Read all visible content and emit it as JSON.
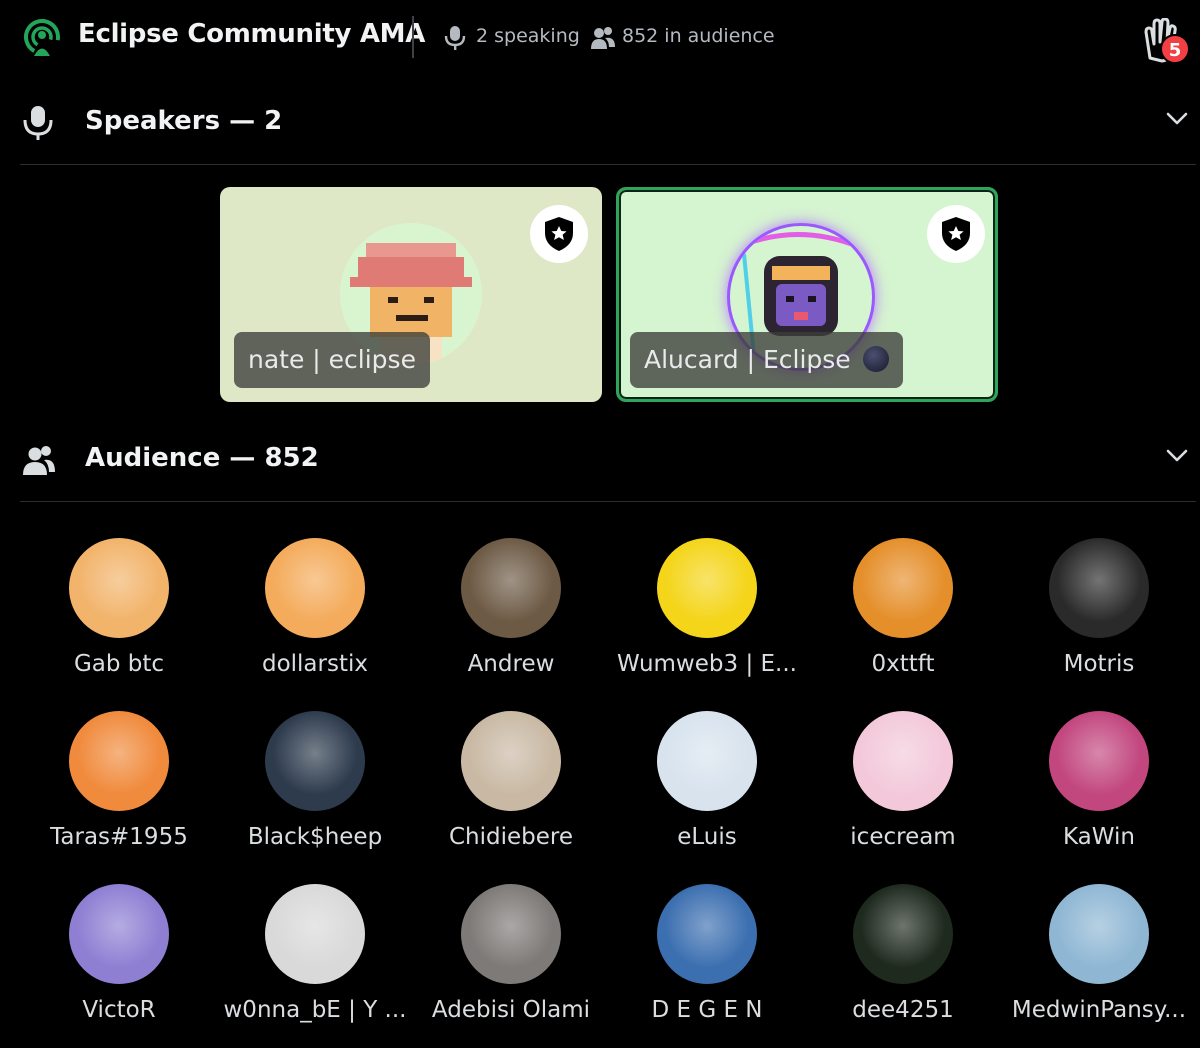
{
  "header": {
    "title": "Eclipse Community AMA",
    "speaking": "2 speaking",
    "audience": "852 in audience",
    "raised_hands": "5",
    "icons": {
      "stage": "stage-channel-icon",
      "mic": "microphone-icon",
      "people": "people-icon",
      "hand": "raise-hand-icon"
    }
  },
  "speakers": {
    "heading": "Speakers — 2",
    "items": [
      {
        "name": "nate | eclipse",
        "bg": "#dfe8c6",
        "avatar_bg": "#d9f5d0",
        "active": false
      },
      {
        "name": "Alucard | Eclipse",
        "bg": "#d5f4d0",
        "avatar_bg": "#6b4fa0",
        "active": true,
        "accent": "#2fa45a"
      }
    ]
  },
  "audience": {
    "heading": "Audience — 852",
    "members": [
      {
        "name": "Gab btc",
        "color": "#f2b36a"
      },
      {
        "name": "dollarstix",
        "color": "#f4ab5b"
      },
      {
        "name": "Andrew",
        "color": "#6d5a45"
      },
      {
        "name": "Wumweb3 | E...",
        "color": "#f4d519"
      },
      {
        "name": "0xttft",
        "color": "#e58f2b"
      },
      {
        "name": "Motris",
        "color": "#2a2a2a"
      },
      {
        "name": "Taras#1955",
        "color": "#f08a3c"
      },
      {
        "name": "Black$heep",
        "color": "#2d3b4d"
      },
      {
        "name": "Chidiebere",
        "color": "#c9b9a4"
      },
      {
        "name": "eLuis",
        "color": "#d8e3ee"
      },
      {
        "name": "icecream",
        "color": "#f3c9da"
      },
      {
        "name": "KaWin",
        "color": "#c2477f"
      },
      {
        "name": "VictoR",
        "color": "#8e7fd3"
      },
      {
        "name": "w0nna_bE | Y ...",
        "color": "#d9d9d9"
      },
      {
        "name": "Adebisi Olami",
        "color": "#7d7a77"
      },
      {
        "name": "D E G E N",
        "color": "#3c6fb0"
      },
      {
        "name": "dee4251",
        "color": "#1f2a1f"
      },
      {
        "name": "MedwinPansy...",
        "color": "#8fb7d4"
      }
    ]
  },
  "colors": {
    "background": "#000000",
    "text": "#f2f3f5",
    "muted": "#b5bac1",
    "green": "#23a55a",
    "badge": "#f23f43"
  }
}
